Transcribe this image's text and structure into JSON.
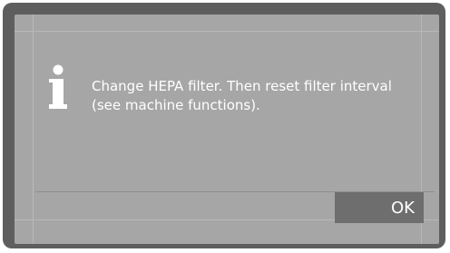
{
  "dialog": {
    "icon": "info-icon",
    "message": "Change HEPA filter. Then reset filter interval (see machine functions).",
    "ok_label": "OK"
  },
  "colors": {
    "bezel": "#5e5e5e",
    "screen": "#a6a6a6",
    "text": "#ffffff",
    "ok_button": "#6e6e6e"
  }
}
